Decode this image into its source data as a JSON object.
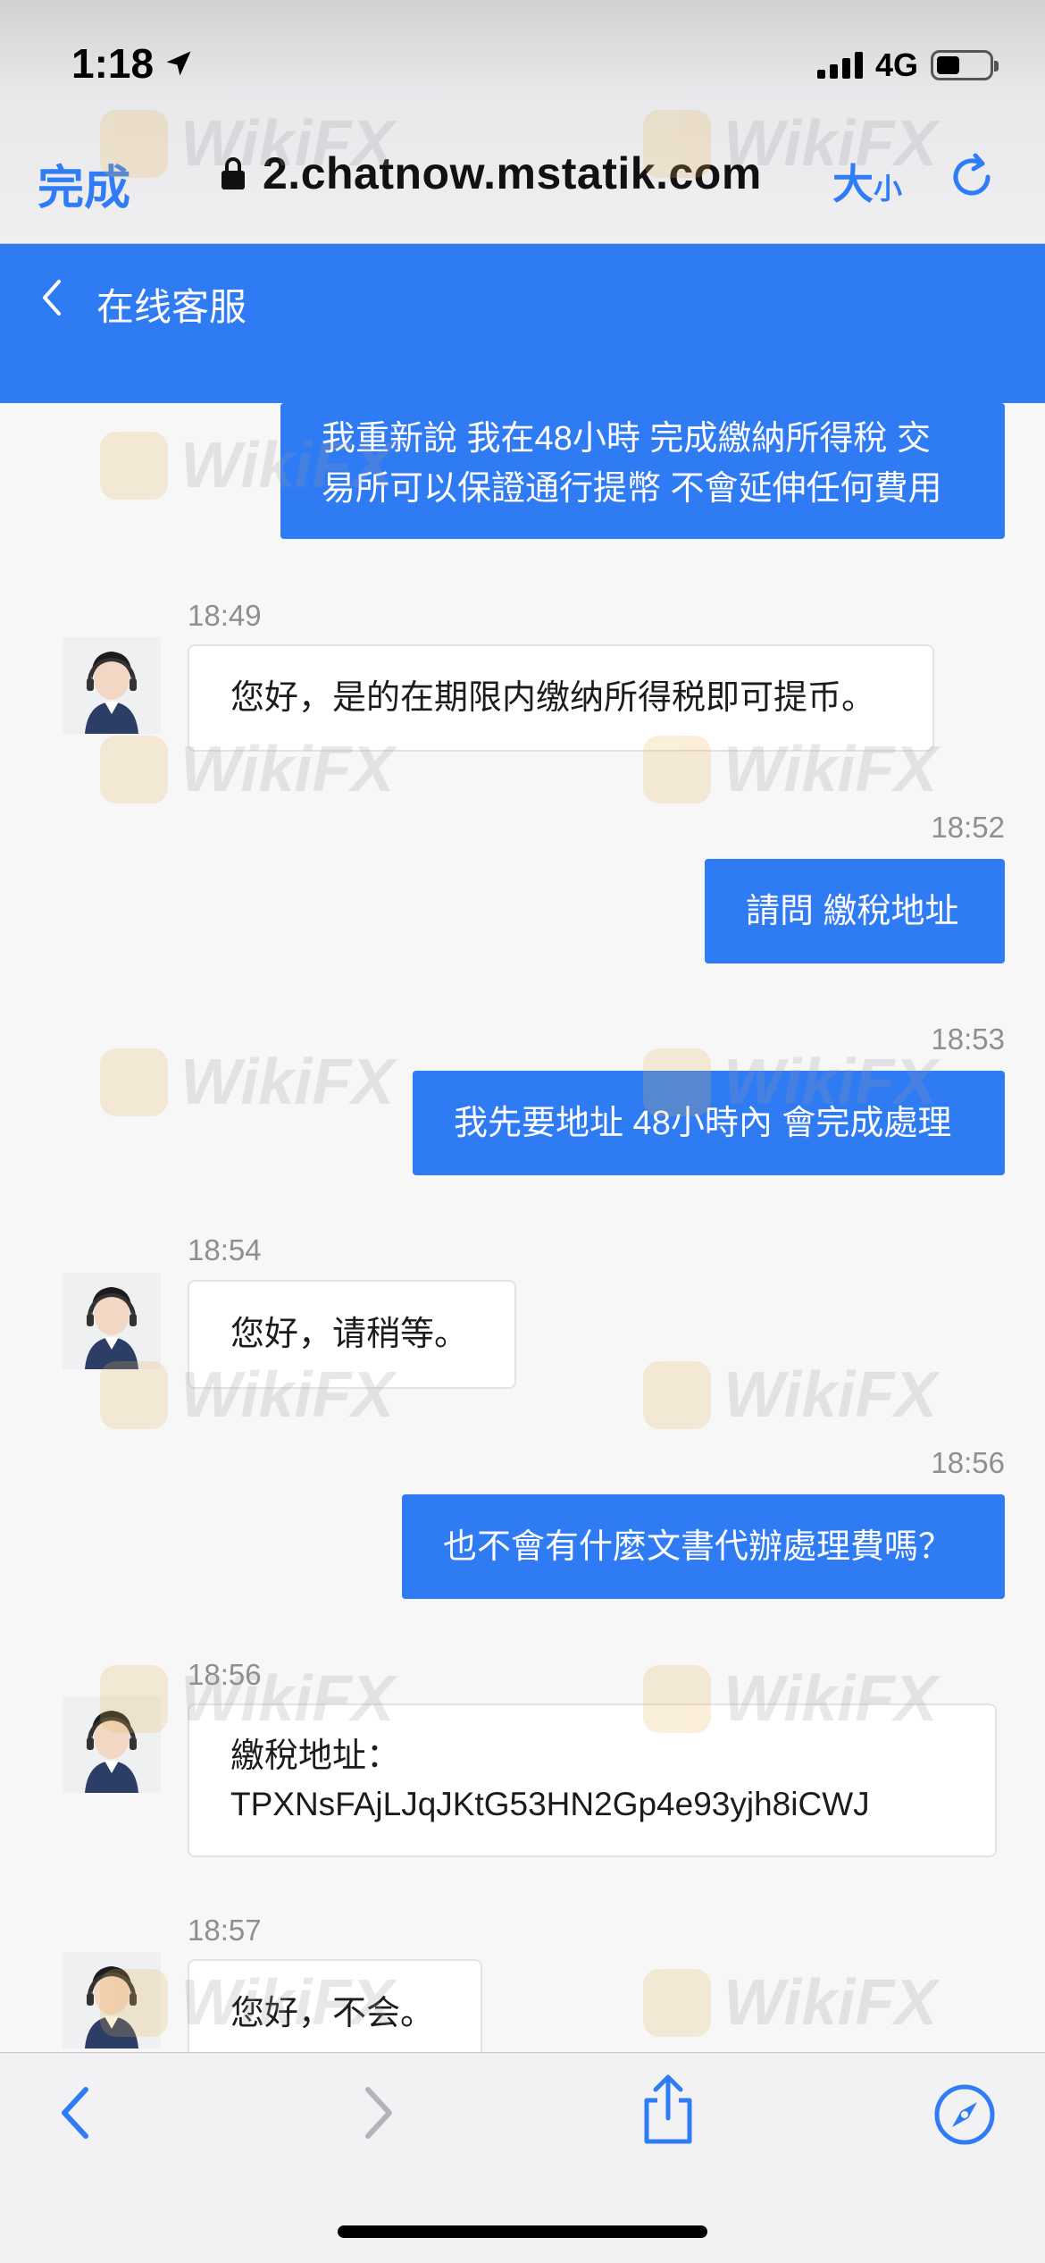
{
  "status_bar": {
    "time": "1:18",
    "network": "4G"
  },
  "browser": {
    "done_label": "完成",
    "url": "2.chatnow.mstatik.com",
    "text_size_big": "大",
    "text_size_small": "小"
  },
  "header": {
    "title": "在线客服"
  },
  "messages": [
    {
      "side": "right",
      "text_lines": [
        "我重新說 我在48小時 完成繳納所得稅 交",
        "易所可以保證通行提幣 不會延伸任何費用"
      ]
    },
    {
      "side": "left",
      "time": "18:49",
      "text": "您好，是的在期限内缴纳所得税即可提币。"
    },
    {
      "side": "right",
      "time": "18:52",
      "text": "請問 繳稅地址"
    },
    {
      "side": "right",
      "time": "18:53",
      "text": "我先要地址 48小時內 會完成處理"
    },
    {
      "side": "left",
      "time": "18:54",
      "text": "您好，请稍等。"
    },
    {
      "side": "right",
      "time": "18:56",
      "text": "也不會有什麼文書代辦處理費嗎？"
    },
    {
      "side": "left",
      "time": "18:56",
      "text_lines": [
        "繳稅地址：",
        "TPXNsFAjLJqJKtG53HN2Gp4e93yjh8iCWJ"
      ]
    },
    {
      "side": "left",
      "time": "18:57",
      "text": "您好，不会。"
    }
  ],
  "watermark": {
    "text": "WikiFX"
  },
  "colors": {
    "accent": "#2e7bf4",
    "ios_blue": "#2f7cf6",
    "timestamp": "#8e8e93"
  },
  "icons": [
    "navigation-arrow-icon",
    "signal-icon",
    "battery-icon",
    "lock-icon",
    "reload-icon",
    "back-chevron-icon",
    "agent-avatar-icon",
    "browser-back-icon",
    "browser-forward-icon",
    "share-icon",
    "compass-icon"
  ]
}
